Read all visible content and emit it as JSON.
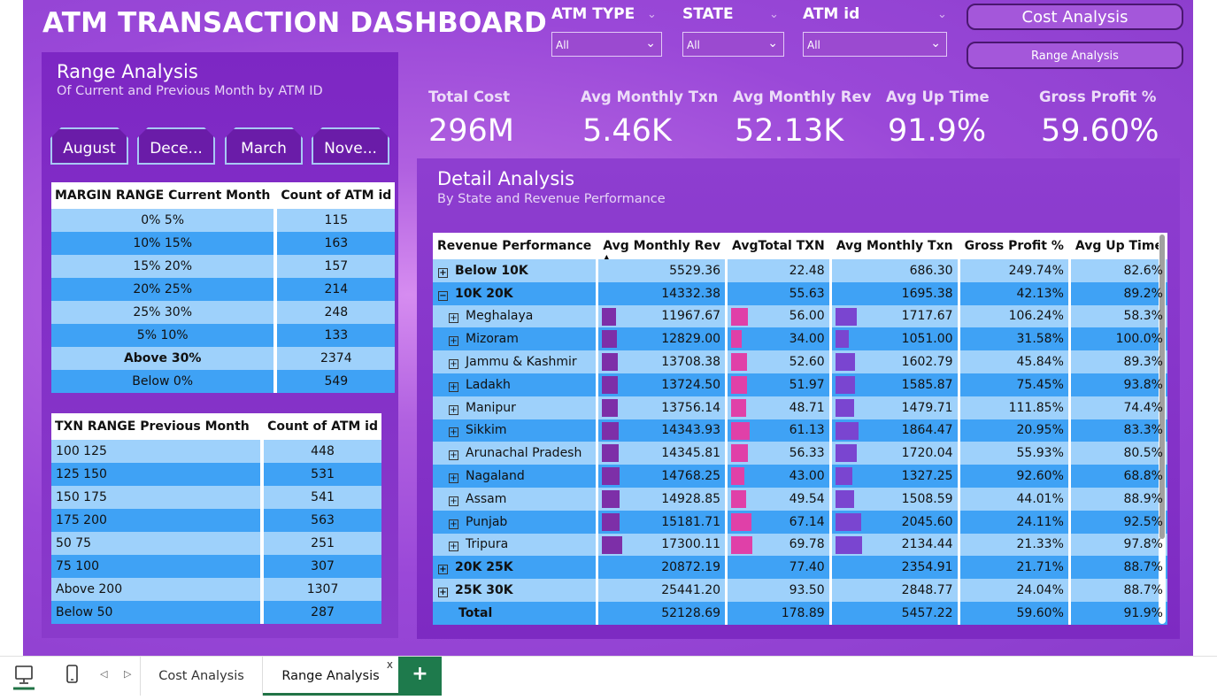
{
  "title": "ATM TRANSACTION DASHBOARD",
  "filters": [
    {
      "label": "ATM TYPE",
      "value": "All"
    },
    {
      "label": "STATE",
      "value": "All"
    },
    {
      "label": "ATM id",
      "value": "All"
    }
  ],
  "nav": {
    "cost_analysis": "Cost Analysis",
    "range_analysis": "Range Analysis"
  },
  "range_panel": {
    "title": "Range Analysis",
    "subtitle": "Of Current and Previous Month by ATM ID",
    "months": [
      "August",
      "Dece...",
      "March",
      "Nove..."
    ],
    "margin_table": {
      "headers": [
        "MARGIN RANGE Current Month",
        "Count of ATM id"
      ],
      "rows": [
        [
          "0% 5%",
          "115"
        ],
        [
          "10% 15%",
          "163"
        ],
        [
          "15% 20%",
          "157"
        ],
        [
          "20% 25%",
          "214"
        ],
        [
          "25% 30%",
          "248"
        ],
        [
          "5% 10%",
          "133"
        ],
        [
          "Above 30%",
          "2374"
        ],
        [
          "Below 0%",
          "549"
        ]
      ]
    },
    "txn_table": {
      "headers": [
        "TXN RANGE Previous Month",
        "Count of ATM id"
      ],
      "rows": [
        [
          "100 125",
          "448"
        ],
        [
          "125 150",
          "531"
        ],
        [
          "150 175",
          "541"
        ],
        [
          "175 200",
          "563"
        ],
        [
          "50 75",
          "251"
        ],
        [
          "75 100",
          "307"
        ],
        [
          "Above 200",
          "1307"
        ],
        [
          "Below 50",
          "287"
        ]
      ]
    }
  },
  "kpis": [
    {
      "label": "Total Cost",
      "value": "296M"
    },
    {
      "label": "Avg Monthly Txn",
      "value": "5.46K"
    },
    {
      "label": "Avg Monthly Rev",
      "value": "52.13K"
    },
    {
      "label": "Avg Up Time",
      "value": "91.9%"
    },
    {
      "label": "Gross Profit %",
      "value": "59.60%"
    }
  ],
  "detail": {
    "title": "Detail Analysis",
    "subtitle": "By State and Revenue Performance",
    "headers": [
      "Revenue Performance",
      "Avg Monthly Rev",
      "AvgTotal TXN",
      "Avg Monthly Txn",
      "Gross Profit %",
      "Avg Up Time"
    ],
    "colors": {
      "rev_bar": "#7d2fa8",
      "txn_bar": "#e040a8",
      "mtxn_bar": "#7a45d0"
    },
    "rows": [
      {
        "label": "Below 10K",
        "level": 0,
        "expander": "+",
        "bold": true,
        "cells": [
          "5529.36",
          "22.48",
          "686.30",
          "249.74%",
          "82.6%"
        ]
      },
      {
        "label": "10K 20K",
        "level": 0,
        "expander": "-",
        "bold": true,
        "cells": [
          "14332.38",
          "55.63",
          "1695.38",
          "42.13%",
          "89.2%"
        ]
      },
      {
        "label": "Meghalaya",
        "level": 1,
        "expander": "+",
        "bold": false,
        "cells": [
          "11967.67",
          "56.00",
          "1717.67",
          "106.24%",
          "58.3%"
        ],
        "bars": [
          11967.67,
          56.0,
          1717.67
        ]
      },
      {
        "label": "Mizoram",
        "level": 1,
        "expander": "+",
        "bold": false,
        "cells": [
          "12829.00",
          "34.00",
          "1051.00",
          "31.58%",
          "100.0%"
        ],
        "bars": [
          12829.0,
          34.0,
          1051.0
        ]
      },
      {
        "label": "Jammu & Kashmir",
        "level": 1,
        "expander": "+",
        "bold": false,
        "cells": [
          "13708.38",
          "52.60",
          "1602.79",
          "45.84%",
          "89.3%"
        ],
        "bars": [
          13708.38,
          52.6,
          1602.79
        ]
      },
      {
        "label": "Ladakh",
        "level": 1,
        "expander": "+",
        "bold": false,
        "cells": [
          "13724.50",
          "51.97",
          "1585.87",
          "75.45%",
          "93.8%"
        ],
        "bars": [
          13724.5,
          51.97,
          1585.87
        ]
      },
      {
        "label": "Manipur",
        "level": 1,
        "expander": "+",
        "bold": false,
        "cells": [
          "13756.14",
          "48.71",
          "1479.71",
          "111.85%",
          "74.4%"
        ],
        "bars": [
          13756.14,
          48.71,
          1479.71
        ]
      },
      {
        "label": "Sikkim",
        "level": 1,
        "expander": "+",
        "bold": false,
        "cells": [
          "14343.93",
          "61.13",
          "1864.47",
          "20.95%",
          "83.3%"
        ],
        "bars": [
          14343.93,
          61.13,
          1864.47
        ]
      },
      {
        "label": "Arunachal Pradesh",
        "level": 1,
        "expander": "+",
        "bold": false,
        "cells": [
          "14345.81",
          "56.33",
          "1720.04",
          "55.93%",
          "80.5%"
        ],
        "bars": [
          14345.81,
          56.33,
          1720.04
        ]
      },
      {
        "label": "Nagaland",
        "level": 1,
        "expander": "+",
        "bold": false,
        "cells": [
          "14768.25",
          "43.00",
          "1327.25",
          "92.60%",
          "68.8%"
        ],
        "bars": [
          14768.25,
          43.0,
          1327.25
        ]
      },
      {
        "label": "Assam",
        "level": 1,
        "expander": "+",
        "bold": false,
        "cells": [
          "14928.85",
          "49.54",
          "1508.59",
          "44.01%",
          "88.9%"
        ],
        "bars": [
          14928.85,
          49.54,
          1508.59
        ]
      },
      {
        "label": "Punjab",
        "level": 1,
        "expander": "+",
        "bold": false,
        "cells": [
          "15181.71",
          "67.14",
          "2045.60",
          "24.11%",
          "92.5%"
        ],
        "bars": [
          15181.71,
          67.14,
          2045.6
        ]
      },
      {
        "label": "Tripura",
        "level": 1,
        "expander": "+",
        "bold": false,
        "cells": [
          "17300.11",
          "69.78",
          "2134.44",
          "21.33%",
          "97.8%"
        ],
        "bars": [
          17300.11,
          69.78,
          2134.44
        ]
      },
      {
        "label": "20K 25K",
        "level": 0,
        "expander": "+",
        "bold": true,
        "cells": [
          "20872.19",
          "77.40",
          "2354.91",
          "21.71%",
          "88.7%"
        ]
      },
      {
        "label": "25K 30K",
        "level": 0,
        "expander": "+",
        "bold": true,
        "cells": [
          "25441.20",
          "93.50",
          "2848.77",
          "24.04%",
          "88.7%"
        ]
      },
      {
        "label": "Total",
        "level": 0,
        "expander": "",
        "bold": true,
        "cells": [
          "52128.69",
          "178.89",
          "5457.22",
          "59.60%",
          "91.9%"
        ]
      }
    ]
  },
  "tabs": [
    {
      "label": "Cost Analysis",
      "active": false
    },
    {
      "label": "Range Analysis",
      "active": true
    }
  ],
  "tab_close": "x",
  "tab_add": "+"
}
